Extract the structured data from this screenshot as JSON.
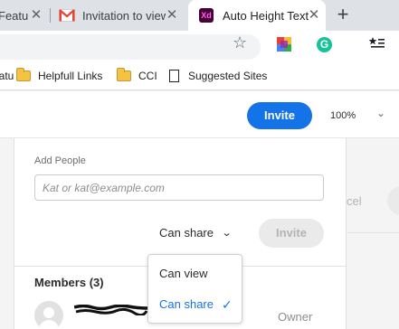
{
  "browser": {
    "tabs": [
      {
        "title": "Featu",
        "active": false
      },
      {
        "title": "Invitation to view",
        "active": false,
        "icon": "gmail-icon"
      },
      {
        "title": "Auto Height Text",
        "active": true,
        "icon": "xd-icon",
        "icon_text": "Xd"
      }
    ],
    "new_tab_symbol": "+",
    "bookmarks": [
      {
        "label": "eatu",
        "icon": "page-icon"
      },
      {
        "label": "Helpfull Links",
        "icon": "folder-icon"
      },
      {
        "label": "CCI",
        "icon": "folder-icon"
      },
      {
        "label": "Suggested Sites",
        "icon": "page-icon"
      }
    ],
    "extensions": {
      "grammarly_letter": "G"
    }
  },
  "app": {
    "invite_button": "Invite",
    "zoom": "100%",
    "background": {
      "cancel_text": "cel"
    }
  },
  "share_dialog": {
    "add_people_label": "Add People",
    "email_placeholder": "Kat or kat@example.com",
    "permission_selected": "Can share",
    "invite_button": "Invite",
    "members_heading": "Members (3)",
    "member_role": "Owner",
    "dropdown_options": [
      {
        "label": "Can view",
        "selected": false
      },
      {
        "label": "Can share",
        "selected": true
      }
    ]
  },
  "colors": {
    "accent": "#1473e6",
    "xd_brand": "#470137",
    "xd_text": "#ff61f6",
    "gmail_red": "#ea4335"
  }
}
